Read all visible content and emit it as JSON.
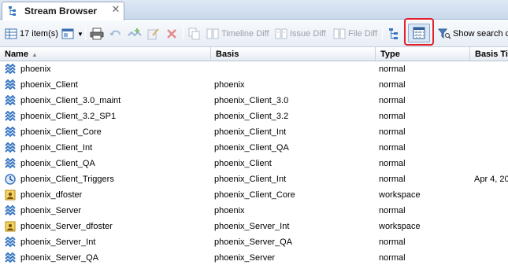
{
  "tab": {
    "title": "Stream Browser",
    "close": "✕"
  },
  "toolbar": {
    "item_count": "17 item(s)",
    "timeline_diff": "Timeline Diff",
    "issue_diff": "Issue Diff",
    "file_diff": "File Diff",
    "show_search": "Show search c"
  },
  "columns": {
    "name": "Name",
    "basis": "Basis",
    "type": "Type",
    "basis_time": "Basis Ti"
  },
  "rows": [
    {
      "icon": "stream-icon",
      "name": "phoenix",
      "basis": "",
      "type": "normal",
      "time": ""
    },
    {
      "icon": "stream-icon",
      "name": "phoenix_Client",
      "basis": "phoenix",
      "type": "normal",
      "time": ""
    },
    {
      "icon": "stream-icon",
      "name": "phoenix_Client_3.0_maint",
      "basis": "phoenix_Client_3.0",
      "type": "normal",
      "time": ""
    },
    {
      "icon": "stream-icon",
      "name": "phoenix_Client_3.2_SP1",
      "basis": "phoenix_Client_3.2",
      "type": "normal",
      "time": ""
    },
    {
      "icon": "stream-icon",
      "name": "phoenix_Client_Core",
      "basis": "phoenix_Client_Int",
      "type": "normal",
      "time": ""
    },
    {
      "icon": "stream-icon",
      "name": "phoenix_Client_Int",
      "basis": "phoenix_Client_QA",
      "type": "normal",
      "time": ""
    },
    {
      "icon": "stream-icon",
      "name": "phoenix_Client_QA",
      "basis": "phoenix_Client",
      "type": "normal",
      "time": ""
    },
    {
      "icon": "clock-icon",
      "name": "phoenix_Client_Triggers",
      "basis": "phoenix_Client_Int",
      "type": "normal",
      "time": "Apr 4, 20"
    },
    {
      "icon": "workspace-icon",
      "name": "phoenix_dfoster",
      "basis": "phoenix_Client_Core",
      "type": "workspace",
      "time": ""
    },
    {
      "icon": "stream-icon",
      "name": "phoenix_Server",
      "basis": "phoenix",
      "type": "normal",
      "time": ""
    },
    {
      "icon": "workspace-icon",
      "name": "phoenix_Server_dfoster",
      "basis": "phoenix_Server_Int",
      "type": "workspace",
      "time": ""
    },
    {
      "icon": "stream-icon",
      "name": "phoenix_Server_Int",
      "basis": "phoenix_Server_QA",
      "type": "normal",
      "time": ""
    },
    {
      "icon": "stream-icon",
      "name": "phoenix_Server_QA",
      "basis": "phoenix_Server",
      "type": "normal",
      "time": ""
    }
  ]
}
